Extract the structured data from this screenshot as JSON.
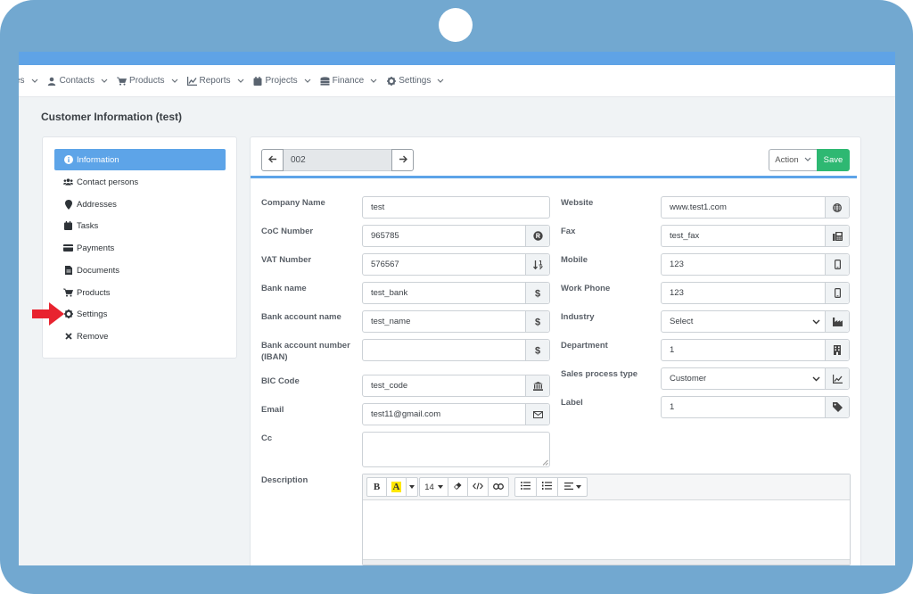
{
  "nav": {
    "items": [
      {
        "label": "es",
        "icon": "none"
      },
      {
        "label": "Contacts",
        "icon": "user-icon"
      },
      {
        "label": "Products",
        "icon": "cart-icon"
      },
      {
        "label": "Reports",
        "icon": "chart-icon"
      },
      {
        "label": "Projects",
        "icon": "calendar-icon"
      },
      {
        "label": "Finance",
        "icon": "coins-icon"
      },
      {
        "label": "Settings",
        "icon": "gear-icon"
      }
    ]
  },
  "page": {
    "title": "Customer Information (test)"
  },
  "sidebar": {
    "items": [
      {
        "label": "Information",
        "icon": "info-icon",
        "active": true
      },
      {
        "label": "Contact persons",
        "icon": "users-icon"
      },
      {
        "label": "Addresses",
        "icon": "map-marker-icon"
      },
      {
        "label": "Tasks",
        "icon": "calendar-icon"
      },
      {
        "label": "Payments",
        "icon": "credit-card-icon"
      },
      {
        "label": "Documents",
        "icon": "file-icon"
      },
      {
        "label": "Products",
        "icon": "cart-icon"
      },
      {
        "label": "Settings",
        "icon": "gear-icon"
      },
      {
        "label": "Remove",
        "icon": "close-icon"
      }
    ]
  },
  "pager": {
    "value": "002"
  },
  "toolbar": {
    "action_label": "Action",
    "save_label": "Save"
  },
  "form": {
    "left": {
      "company_name": {
        "label": "Company Name",
        "value": "test"
      },
      "coc_number": {
        "label": "CoC Number",
        "value": "965785"
      },
      "vat_number": {
        "label": "VAT Number",
        "value": "576567"
      },
      "bank_name": {
        "label": "Bank name",
        "value": "test_bank"
      },
      "bank_account_name": {
        "label": "Bank account name",
        "value": "test_name"
      },
      "bank_account_number": {
        "label_line1": "Bank account number",
        "label_line2": "(IBAN)",
        "value": ""
      },
      "bic_code": {
        "label": "BIC Code",
        "value": "test_code"
      },
      "email": {
        "label": "Email",
        "value": "test11@gmail.com"
      },
      "cc": {
        "label": "Cc",
        "value": ""
      },
      "description": {
        "label": "Description"
      }
    },
    "right": {
      "website": {
        "label": "Website",
        "value": "www.test1.com"
      },
      "fax": {
        "label": "Fax",
        "value": "test_fax"
      },
      "mobile": {
        "label": "Mobile",
        "value": "123"
      },
      "work_phone": {
        "label": "Work Phone",
        "value": "123"
      },
      "industry": {
        "label": "Industry",
        "value": "Select"
      },
      "department": {
        "label": "Department",
        "value": "1"
      },
      "sales_process_type": {
        "label": "Sales process type",
        "value": "Customer"
      },
      "label": {
        "label": "Label",
        "value": "1"
      }
    }
  },
  "editor": {
    "bold": "B",
    "highlight": "A",
    "font_size": "14"
  },
  "colors": {
    "accent": "#5da4e8",
    "save": "#2eb872",
    "frame": "#72a8d0",
    "arrow": "#e8232f"
  }
}
